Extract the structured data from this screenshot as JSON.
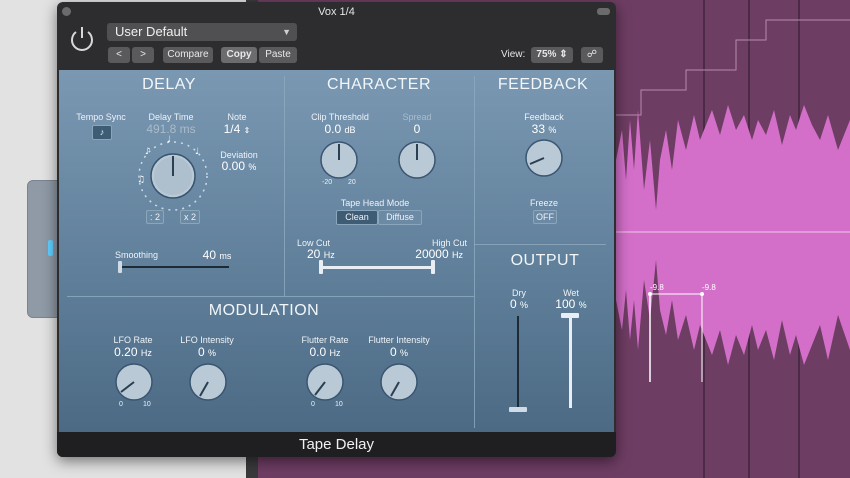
{
  "window": {
    "title": "Vox 1/4"
  },
  "toolbar": {
    "preset": "User Default",
    "back": "<",
    "forward": ">",
    "compare": "Compare",
    "copy": "Copy",
    "paste": "Paste",
    "view_label": "View:",
    "view_value": "75%"
  },
  "delay": {
    "title": "DELAY",
    "tempo_sync_label": "Tempo Sync",
    "delay_time_label": "Delay Time",
    "delay_time_value": "491.8 ms",
    "note_label": "Note",
    "note_value": "1/4",
    "deviation_label": "Deviation",
    "deviation_value": "0.00",
    "deviation_unit": "%",
    "half_btn": ": 2",
    "double_btn": "x 2",
    "smoothing_label": "Smoothing",
    "smoothing_value": "40",
    "smoothing_unit": "ms"
  },
  "character": {
    "title": "CHARACTER",
    "clip_label": "Clip Threshold",
    "clip_value": "0.0",
    "clip_unit": "dB",
    "clip_min": "-20",
    "clip_max": "20",
    "spread_label": "Spread",
    "spread_value": "0",
    "tape_head_label": "Tape Head Mode",
    "mode_clean": "Clean",
    "mode_diffuse": "Diffuse",
    "lowcut_label": "Low Cut",
    "lowcut_value": "20",
    "lowcut_unit": "Hz",
    "highcut_label": "High Cut",
    "highcut_value": "20000",
    "highcut_unit": "Hz"
  },
  "feedback": {
    "title": "FEEDBACK",
    "feedback_label": "Feedback",
    "feedback_value": "33",
    "feedback_unit": "%",
    "freeze_label": "Freeze",
    "freeze_value": "OFF"
  },
  "output": {
    "title": "OUTPUT",
    "dry_label": "Dry",
    "dry_value": "0",
    "dry_unit": "%",
    "wet_label": "Wet",
    "wet_value": "100",
    "wet_unit": "%"
  },
  "modulation": {
    "title": "MODULATION",
    "lfo_rate_label": "LFO Rate",
    "lfo_rate_value": "0.20",
    "lfo_rate_unit": "Hz",
    "lfo_rate_min": "0",
    "lfo_rate_max": "10",
    "lfo_int_label": "LFO Intensity",
    "lfo_int_value": "0",
    "lfo_int_unit": "%",
    "flutter_rate_label": "Flutter Rate",
    "flutter_rate_value": "0.0",
    "flutter_rate_unit": "Hz",
    "flutter_rate_min": "0",
    "flutter_rate_max": "10",
    "flutter_int_label": "Flutter Intensity",
    "flutter_int_value": "0",
    "flutter_int_unit": "%"
  },
  "plugin_name": "Tape Delay",
  "track": {
    "marker_a": "-9.8",
    "marker_b": "-9.8"
  },
  "colors": {
    "panel_top": "#7a98b2",
    "panel_bottom": "#4c6a84",
    "waveform": "#d36fc9",
    "track_bg": "#6e3d63"
  }
}
